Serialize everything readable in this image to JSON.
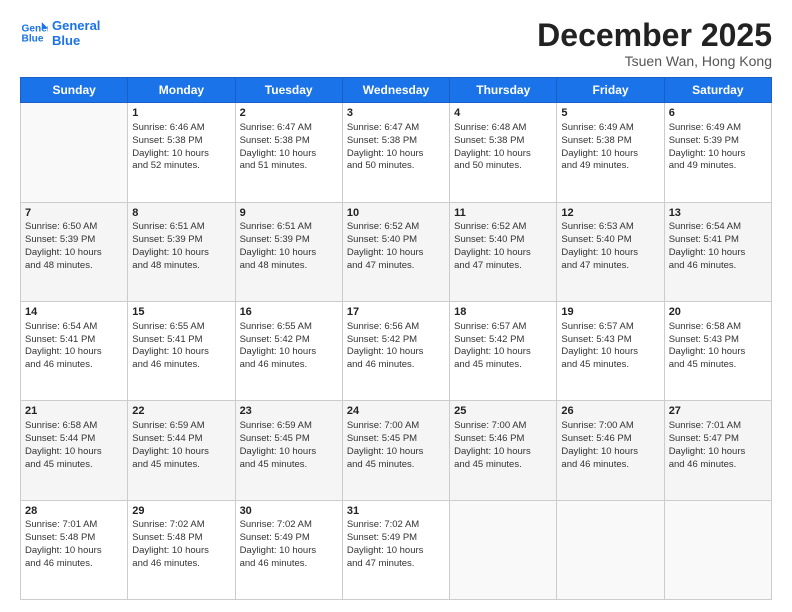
{
  "logo": {
    "line1": "General",
    "line2": "Blue"
  },
  "title": "December 2025",
  "location": "Tsuen Wan, Hong Kong",
  "days": [
    "Sunday",
    "Monday",
    "Tuesday",
    "Wednesday",
    "Thursday",
    "Friday",
    "Saturday"
  ],
  "weeks": [
    [
      {
        "day": "",
        "info": ""
      },
      {
        "day": "1",
        "info": "Sunrise: 6:46 AM\nSunset: 5:38 PM\nDaylight: 10 hours\nand 52 minutes."
      },
      {
        "day": "2",
        "info": "Sunrise: 6:47 AM\nSunset: 5:38 PM\nDaylight: 10 hours\nand 51 minutes."
      },
      {
        "day": "3",
        "info": "Sunrise: 6:47 AM\nSunset: 5:38 PM\nDaylight: 10 hours\nand 50 minutes."
      },
      {
        "day": "4",
        "info": "Sunrise: 6:48 AM\nSunset: 5:38 PM\nDaylight: 10 hours\nand 50 minutes."
      },
      {
        "day": "5",
        "info": "Sunrise: 6:49 AM\nSunset: 5:38 PM\nDaylight: 10 hours\nand 49 minutes."
      },
      {
        "day": "6",
        "info": "Sunrise: 6:49 AM\nSunset: 5:39 PM\nDaylight: 10 hours\nand 49 minutes."
      }
    ],
    [
      {
        "day": "7",
        "info": "Sunrise: 6:50 AM\nSunset: 5:39 PM\nDaylight: 10 hours\nand 48 minutes."
      },
      {
        "day": "8",
        "info": "Sunrise: 6:51 AM\nSunset: 5:39 PM\nDaylight: 10 hours\nand 48 minutes."
      },
      {
        "day": "9",
        "info": "Sunrise: 6:51 AM\nSunset: 5:39 PM\nDaylight: 10 hours\nand 48 minutes."
      },
      {
        "day": "10",
        "info": "Sunrise: 6:52 AM\nSunset: 5:40 PM\nDaylight: 10 hours\nand 47 minutes."
      },
      {
        "day": "11",
        "info": "Sunrise: 6:52 AM\nSunset: 5:40 PM\nDaylight: 10 hours\nand 47 minutes."
      },
      {
        "day": "12",
        "info": "Sunrise: 6:53 AM\nSunset: 5:40 PM\nDaylight: 10 hours\nand 47 minutes."
      },
      {
        "day": "13",
        "info": "Sunrise: 6:54 AM\nSunset: 5:41 PM\nDaylight: 10 hours\nand 46 minutes."
      }
    ],
    [
      {
        "day": "14",
        "info": "Sunrise: 6:54 AM\nSunset: 5:41 PM\nDaylight: 10 hours\nand 46 minutes."
      },
      {
        "day": "15",
        "info": "Sunrise: 6:55 AM\nSunset: 5:41 PM\nDaylight: 10 hours\nand 46 minutes."
      },
      {
        "day": "16",
        "info": "Sunrise: 6:55 AM\nSunset: 5:42 PM\nDaylight: 10 hours\nand 46 minutes."
      },
      {
        "day": "17",
        "info": "Sunrise: 6:56 AM\nSunset: 5:42 PM\nDaylight: 10 hours\nand 46 minutes."
      },
      {
        "day": "18",
        "info": "Sunrise: 6:57 AM\nSunset: 5:42 PM\nDaylight: 10 hours\nand 45 minutes."
      },
      {
        "day": "19",
        "info": "Sunrise: 6:57 AM\nSunset: 5:43 PM\nDaylight: 10 hours\nand 45 minutes."
      },
      {
        "day": "20",
        "info": "Sunrise: 6:58 AM\nSunset: 5:43 PM\nDaylight: 10 hours\nand 45 minutes."
      }
    ],
    [
      {
        "day": "21",
        "info": "Sunrise: 6:58 AM\nSunset: 5:44 PM\nDaylight: 10 hours\nand 45 minutes."
      },
      {
        "day": "22",
        "info": "Sunrise: 6:59 AM\nSunset: 5:44 PM\nDaylight: 10 hours\nand 45 minutes."
      },
      {
        "day": "23",
        "info": "Sunrise: 6:59 AM\nSunset: 5:45 PM\nDaylight: 10 hours\nand 45 minutes."
      },
      {
        "day": "24",
        "info": "Sunrise: 7:00 AM\nSunset: 5:45 PM\nDaylight: 10 hours\nand 45 minutes."
      },
      {
        "day": "25",
        "info": "Sunrise: 7:00 AM\nSunset: 5:46 PM\nDaylight: 10 hours\nand 45 minutes."
      },
      {
        "day": "26",
        "info": "Sunrise: 7:00 AM\nSunset: 5:46 PM\nDaylight: 10 hours\nand 46 minutes."
      },
      {
        "day": "27",
        "info": "Sunrise: 7:01 AM\nSunset: 5:47 PM\nDaylight: 10 hours\nand 46 minutes."
      }
    ],
    [
      {
        "day": "28",
        "info": "Sunrise: 7:01 AM\nSunset: 5:48 PM\nDaylight: 10 hours\nand 46 minutes."
      },
      {
        "day": "29",
        "info": "Sunrise: 7:02 AM\nSunset: 5:48 PM\nDaylight: 10 hours\nand 46 minutes."
      },
      {
        "day": "30",
        "info": "Sunrise: 7:02 AM\nSunset: 5:49 PM\nDaylight: 10 hours\nand 46 minutes."
      },
      {
        "day": "31",
        "info": "Sunrise: 7:02 AM\nSunset: 5:49 PM\nDaylight: 10 hours\nand 47 minutes."
      },
      {
        "day": "",
        "info": ""
      },
      {
        "day": "",
        "info": ""
      },
      {
        "day": "",
        "info": ""
      }
    ]
  ]
}
